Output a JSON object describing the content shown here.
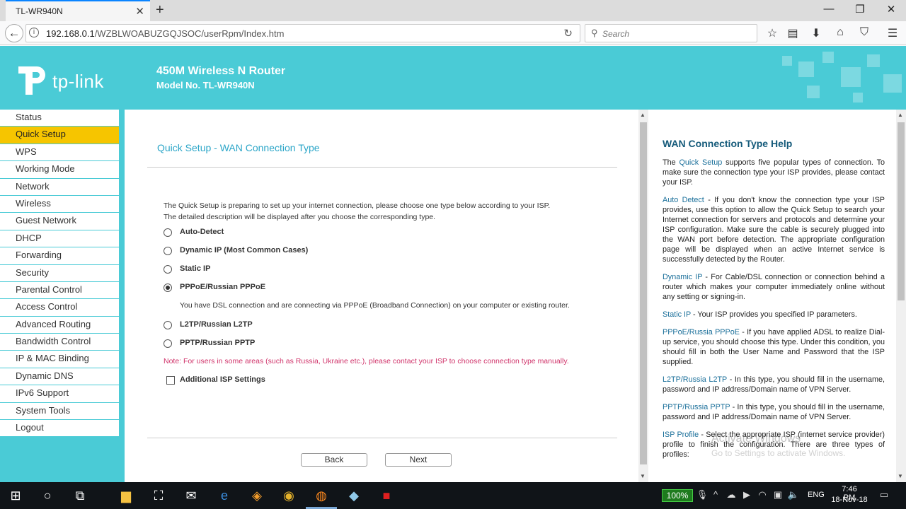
{
  "browser": {
    "tab_title": "TL-WR940N",
    "url_host": "192.168.0.1",
    "url_path": "/WZBLWOABUZGQJSOC/userRpm/Index.htm",
    "search_placeholder": "Search"
  },
  "header": {
    "logo_text": "tp-link",
    "title": "450M Wireless N Router",
    "model": "Model No. TL-WR940N"
  },
  "sidebar": {
    "items": [
      {
        "label": "Status"
      },
      {
        "label": "Quick Setup"
      },
      {
        "label": "WPS"
      },
      {
        "label": "Working Mode"
      },
      {
        "label": "Network"
      },
      {
        "label": "Wireless"
      },
      {
        "label": "Guest Network"
      },
      {
        "label": "DHCP"
      },
      {
        "label": "Forwarding"
      },
      {
        "label": "Security"
      },
      {
        "label": "Parental Control"
      },
      {
        "label": "Access Control"
      },
      {
        "label": "Advanced Routing"
      },
      {
        "label": "Bandwidth Control"
      },
      {
        "label": "IP & MAC Binding"
      },
      {
        "label": "Dynamic DNS"
      },
      {
        "label": "IPv6 Support"
      },
      {
        "label": "System Tools"
      },
      {
        "label": "Logout"
      }
    ],
    "active": "Quick Setup"
  },
  "main": {
    "title": "Quick Setup - WAN Connection Type",
    "intro_line1": "The Quick Setup is preparing to set up your internet connection, please choose one type below according to your ISP.",
    "intro_line2": "The detailed description will be displayed after you choose the corresponding type.",
    "options": [
      {
        "label": "Auto-Detect",
        "checked": false
      },
      {
        "label": "Dynamic IP (Most Common Cases)",
        "checked": false
      },
      {
        "label": "Static IP",
        "checked": false
      },
      {
        "label": "PPPoE/Russian PPPoE",
        "checked": true
      },
      {
        "label": "L2TP/Russian L2TP",
        "checked": false
      },
      {
        "label": "PPTP/Russian PPTP",
        "checked": false
      }
    ],
    "pppoe_desc": "You have DSL connection and are connecting via PPPoE (Broadband Connection) on your computer or existing router.",
    "note": "Note: For users in some areas (such as Russia, Ukraine etc.), please contact your ISP to choose connection type manually.",
    "additional_isp": "Additional ISP Settings",
    "back_label": "Back",
    "next_label": "Next"
  },
  "help": {
    "title": "WAN Connection Type Help",
    "p1_pre": "The ",
    "p1_hl": "Quick Setup",
    "p1_post": " supports five popular types of connection. To make sure the connection type your ISP provides, please contact your ISP.",
    "auto_hl": "Auto Detect",
    "auto_text": " - If you don't know the connection type your ISP provides, use this option to allow the Quick Setup to search your Internet connection for servers and protocols and determine your ISP configuration. Make sure the cable is securely plugged into the WAN port before detection. The appropriate configuration page will be displayed when an active Internet service is successfully detected by the Router.",
    "dyn_hl": "Dynamic IP",
    "dyn_text": " - For Cable/DSL connection or connection behind a router which makes your computer immediately online without any setting or signing-in.",
    "static_hl": "Static IP",
    "static_text": " - Your ISP provides you specified IP parameters.",
    "pppoe_hl": "PPPoE/Russia PPPoE",
    "pppoe_text": " - If you have applied ADSL to realize Dial-up service, you should choose this type. Under this condition, you should fill in both the User Name and Password that the ISP supplied.",
    "l2tp_hl": "L2TP/Russia L2TP",
    "l2tp_text": " - In this type, you should fill in the username, password and IP address/Domain name of VPN Server.",
    "pptp_hl": "PPTP/Russia PPTP",
    "pptp_text": " - In this type, you should fill in the username, password and IP address/Domain name of VPN Server.",
    "isp_hl": "ISP Profile",
    "isp_text": " - Select the appropriate ISP (internet service provider) profile to finish the configuration. There are three types of profiles:"
  },
  "watermark": {
    "line1": "Activate Windows",
    "line2": "Go to Settings to activate Windows."
  },
  "taskbar": {
    "battery": "100%",
    "lang": "ENG",
    "time": "7:46 PM",
    "date": "18-Nov-18"
  },
  "colors": {
    "teal": "#4acbd6",
    "active_yellow": "#f6c500",
    "title_blue": "#2ca6c8",
    "note_pink": "#d0336a"
  }
}
